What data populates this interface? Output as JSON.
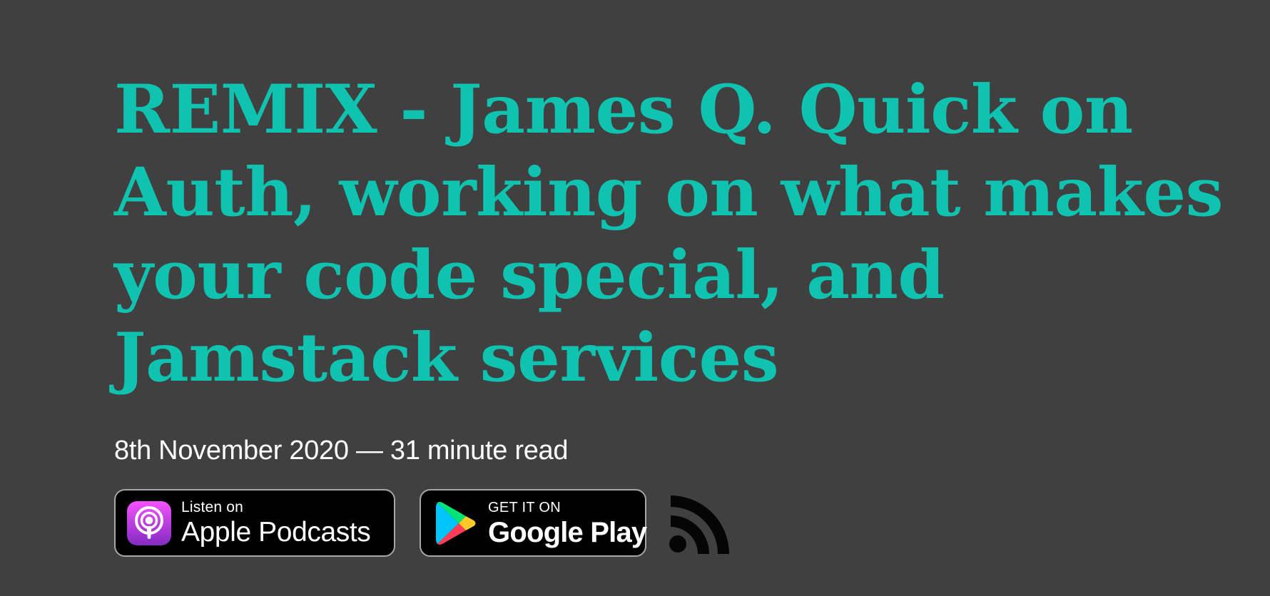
{
  "article": {
    "title": "REMIX - James Q. Quick on Auth, working on what makes your code special, and Jamstack services",
    "date": "8th November 2020",
    "separator": "—",
    "read_time": "31 minute read"
  },
  "badges": {
    "apple": {
      "small_label": "Listen on",
      "large_label": "Apple Podcasts",
      "icon": "apple-podcasts-icon"
    },
    "google": {
      "small_label": "GET IT ON",
      "large_label": "Google Play",
      "icon": "google-play-icon"
    },
    "rss": {
      "icon": "rss-feed-icon"
    }
  },
  "colors": {
    "background": "#404040",
    "title": "#0fc3b0",
    "text": "#ffffff",
    "badge_background": "#000000",
    "badge_border": "#a7a7a7",
    "rss_icon": "#050505"
  }
}
